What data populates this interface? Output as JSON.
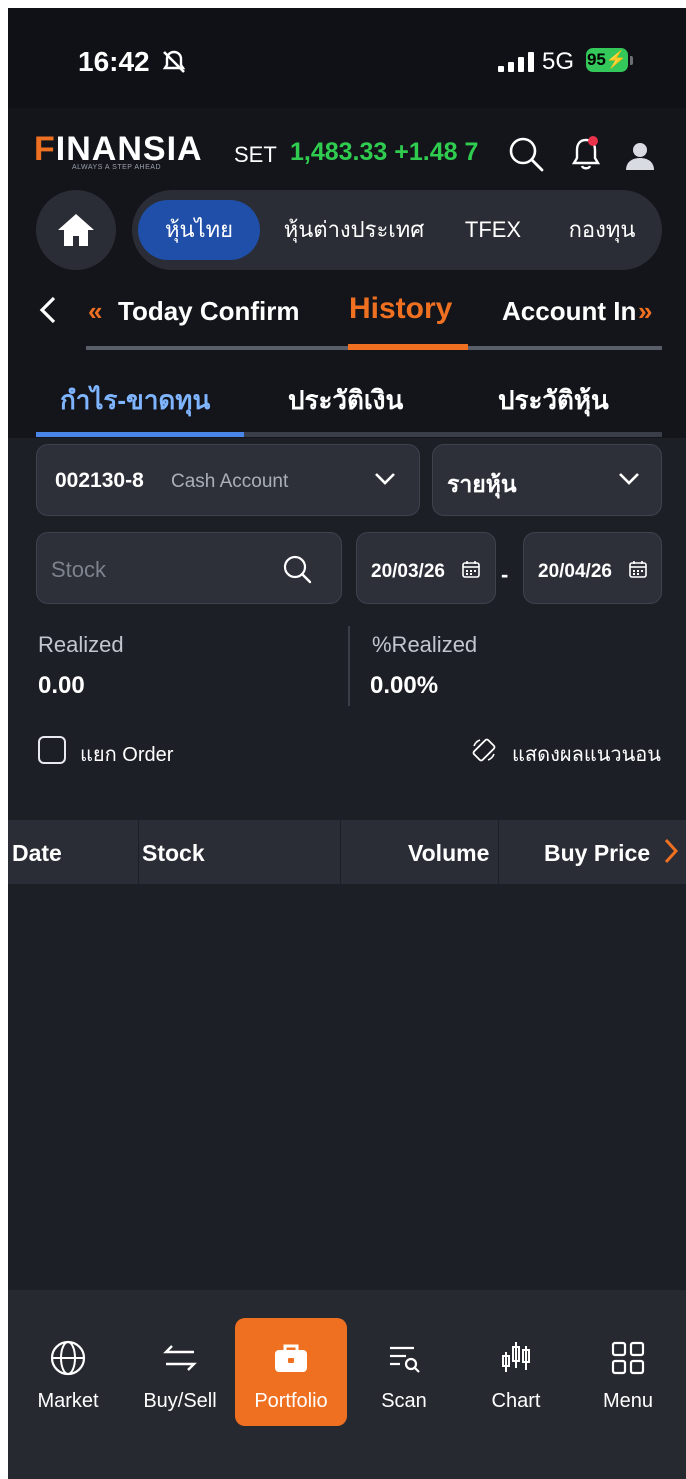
{
  "status_bar": {
    "time": "16:42",
    "network": "5G",
    "battery": "95"
  },
  "header": {
    "brand_rest": "INANSIA",
    "tagline": "ALWAYS A STEP AHEAD",
    "index_label": "SET",
    "index_value": "1,483.33",
    "index_change": "+1.48 7",
    "index_color": "#2fcc4f"
  },
  "segment_tabs": [
    "หุ้นไทย",
    "หุ้นต่างประเทศ",
    "TFEX",
    "กองทุน"
  ],
  "subnav": {
    "prev_arrow": "«",
    "next_arrow": "»",
    "items": [
      "Today Confirm",
      "History",
      "Account In"
    ]
  },
  "tabs": [
    "กำไร-ขาดทุน",
    "ประวัติเงิน",
    "ประวัติหุ้น"
  ],
  "account": {
    "number": "002130-8",
    "type": "Cash Account"
  },
  "view_select": "รายหุ้น",
  "search": {
    "placeholder": "Stock"
  },
  "date_range": {
    "from": "20/03/26",
    "to": "20/04/26",
    "separator": "-"
  },
  "stats": {
    "realized_label": "Realized",
    "realized_value": "0.00",
    "pct_label": "%Realized",
    "pct_value": "0.00%"
  },
  "options": {
    "split_order_label": "แยก Order",
    "landscape_label": "แสดงผลแนวนอน"
  },
  "table": {
    "columns": [
      "Date",
      "Stock",
      "Volume",
      "Buy Price"
    ]
  },
  "bottom_nav": [
    "Market",
    "Buy/Sell",
    "Portfolio",
    "Scan",
    "Chart",
    "Menu"
  ],
  "accent_color": "#f07021"
}
